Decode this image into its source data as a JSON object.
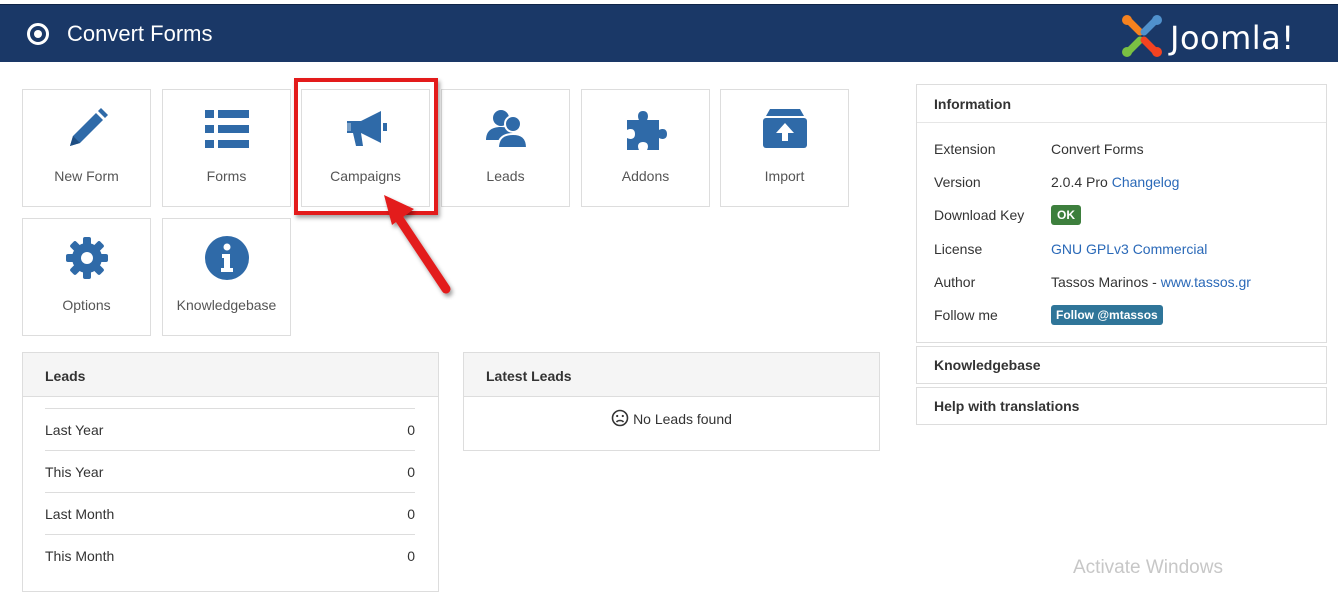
{
  "header": {
    "title": "Convert Forms",
    "brand": "Joomla!"
  },
  "tiles": [
    {
      "label": "New Form",
      "icon": "pencil-icon"
    },
    {
      "label": "Forms",
      "icon": "list-icon"
    },
    {
      "label": "Campaigns",
      "icon": "bullhorn-icon"
    },
    {
      "label": "Leads",
      "icon": "users-icon"
    },
    {
      "label": "Addons",
      "icon": "puzzle-icon"
    },
    {
      "label": "Import",
      "icon": "upload-box-icon"
    },
    {
      "label": "Options",
      "icon": "gear-icon"
    },
    {
      "label": "Knowledgebase",
      "icon": "info-circle-icon"
    }
  ],
  "leads_panel": {
    "title": "Leads",
    "rows": [
      {
        "label": "Last Year",
        "value": "0"
      },
      {
        "label": "This Year",
        "value": "0"
      },
      {
        "label": "Last Month",
        "value": "0"
      },
      {
        "label": "This Month",
        "value": "0"
      }
    ]
  },
  "latest_leads": {
    "title": "Latest Leads",
    "empty_text": "No Leads found"
  },
  "information": {
    "title": "Information",
    "extension_label": "Extension",
    "extension_value": "Convert Forms",
    "version_label": "Version",
    "version_value": "2.0.4 Pro",
    "changelog_link": "Changelog",
    "download_key_label": "Download Key",
    "download_key_badge": "OK",
    "license_label": "License",
    "license_value": "GNU GPLv3 Commercial",
    "author_label": "Author",
    "author_value": "Tassos Marinos - ",
    "author_link": "www.tassos.gr",
    "follow_label": "Follow me",
    "follow_button": "Follow @mtassos"
  },
  "sidebar_sections": {
    "knowledgebase": "Knowledgebase",
    "translations": "Help with translations"
  },
  "watermark": "Activate Windows",
  "colors": {
    "header": "#1a3867",
    "icon": "#2f6aa8",
    "highlight": "#e31b1b",
    "ok": "#3d7f3d",
    "follow": "#2f7599"
  }
}
